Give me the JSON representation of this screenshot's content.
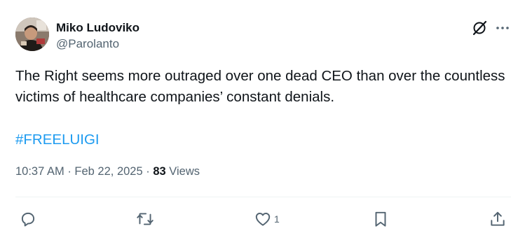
{
  "author": {
    "display_name": "Miko Ludoviko",
    "handle": "@Parolanto",
    "avatar_icon": "profile-photo"
  },
  "tweet": {
    "text": "The Right seems more outraged over one dead CEO than over the countless victims of healthcare companies’ constant denials.",
    "hashtag": "#FREELUIGI"
  },
  "meta": {
    "time": "10:37 AM",
    "separator": "·",
    "date": "Feb 22, 2025",
    "views_count": "83",
    "views_label": "Views"
  },
  "actions": {
    "reply_icon": "reply-icon",
    "retweet_icon": "retweet-icon",
    "like_icon": "heart-icon",
    "like_count": "1",
    "bookmark_icon": "bookmark-icon",
    "share_icon": "share-icon"
  },
  "header_icons": {
    "grok": "grok-icon",
    "more": "more-icon"
  },
  "colors": {
    "text": "#0f1419",
    "secondary": "#536471",
    "link": "#1d9bf0",
    "divider": "#eff3f4"
  }
}
